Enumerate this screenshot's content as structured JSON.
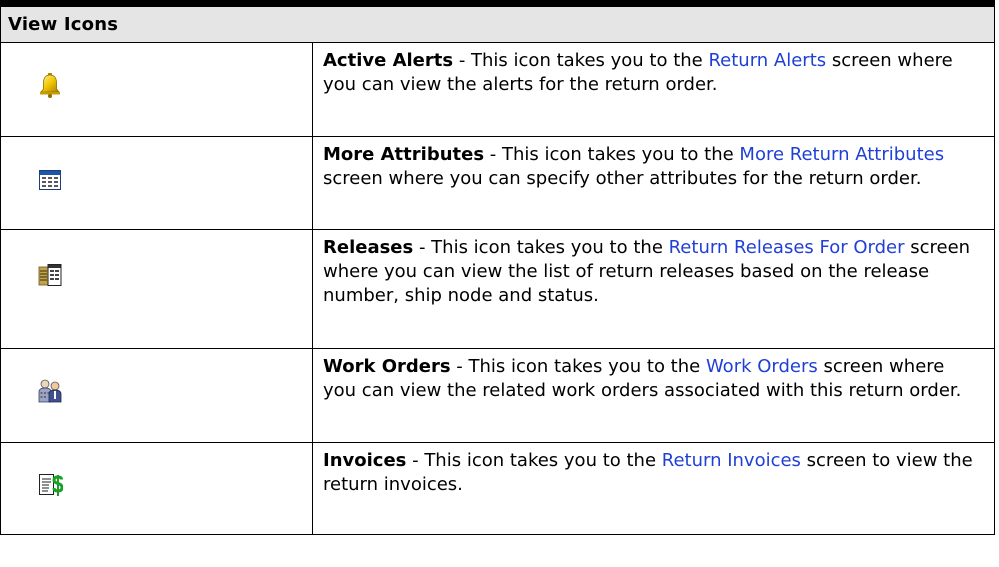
{
  "table": {
    "header": "View Icons",
    "rows": [
      {
        "icon": "bell-icon",
        "term": "Active Alerts",
        "pre": " - This icon takes you to the ",
        "link": "Return Alerts",
        "post": " screen where you can view the alerts for the return order."
      },
      {
        "icon": "grid-table-icon",
        "term": "More Attributes",
        "pre": " - This icon takes you to the ",
        "link": "More Return Attributes",
        "post": " screen where you can specify other attributes for the return order."
      },
      {
        "icon": "releases-icon",
        "term": "Releases",
        "pre": " - This icon takes you to the ",
        "link": "Return Releases For Order",
        "post": " screen where you can view the list of return releases based on the release number, ship node and status."
      },
      {
        "icon": "work-orders-icon",
        "term": "Work Orders",
        "pre": " - This icon takes you to the ",
        "link": "Work Orders",
        "post": " screen where you can view the related work orders associated with this return order."
      },
      {
        "icon": "invoice-dollar-icon",
        "term": "Invoices",
        "pre": " - This icon takes you to the ",
        "link": "Return Invoices",
        "post": " screen to view the return invoices."
      }
    ]
  }
}
